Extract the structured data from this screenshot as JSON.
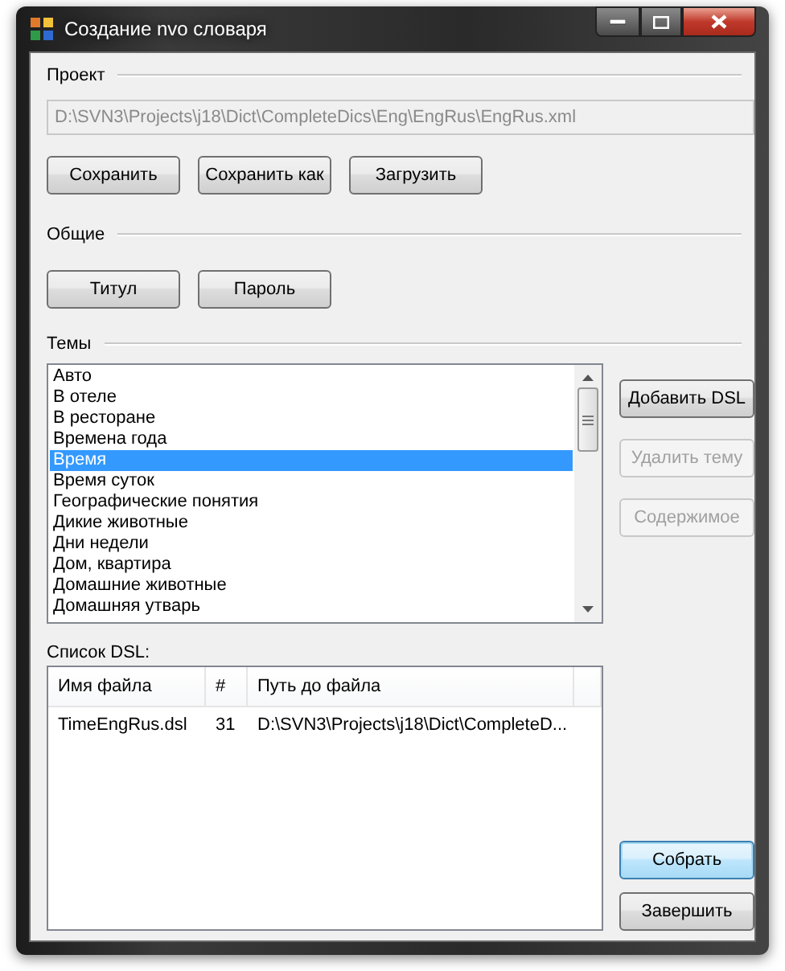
{
  "window": {
    "title": "Создание nvo словаря"
  },
  "project": {
    "label": "Проект",
    "path": "D:\\SVN3\\Projects\\j18\\Dict\\CompleteDics\\Eng\\EngRus\\EngRus.xml",
    "path_disabled": true,
    "buttons": [
      {
        "label": "Сохранить",
        "disabled": false,
        "default": false
      },
      {
        "label": "Сохранить как",
        "disabled": false,
        "default": false
      },
      {
        "label": "Загрузить",
        "disabled": false,
        "default": false
      }
    ]
  },
  "general": {
    "label": "Общие",
    "buttons": [
      {
        "label": "Титул",
        "disabled": false,
        "default": false
      },
      {
        "label": "Пароль",
        "disabled": false,
        "default": false
      }
    ]
  },
  "topics": {
    "label": "Темы",
    "items": [
      {
        "label": "Авто",
        "selected": false
      },
      {
        "label": "В отеле",
        "selected": false
      },
      {
        "label": "В ресторане",
        "selected": false
      },
      {
        "label": "Времена года",
        "selected": false
      },
      {
        "label": "Время",
        "selected": true
      },
      {
        "label": "Время суток",
        "selected": false
      },
      {
        "label": "Географические понятия",
        "selected": false
      },
      {
        "label": "Дикие животные",
        "selected": false
      },
      {
        "label": "Дни недели",
        "selected": false
      },
      {
        "label": "Дом, квартира",
        "selected": false
      },
      {
        "label": "Домашние животные",
        "selected": false
      },
      {
        "label": "Домашняя утварь",
        "selected": false
      }
    ],
    "buttons": [
      {
        "label": "Добавить DSL",
        "disabled": false,
        "default": false
      },
      {
        "label": "Удалить тему",
        "disabled": true,
        "default": false
      },
      {
        "label": "Содержимое",
        "disabled": true,
        "default": false
      }
    ]
  },
  "dsl_list": {
    "label": "Список DSL:",
    "columns": [
      "Имя файла",
      "#",
      "Путь до файла"
    ],
    "rows": [
      [
        "TimeEngRus.dsl",
        "31",
        "D:\\SVN3\\Projects\\j18\\Dict\\CompleteD..."
      ]
    ]
  },
  "footer_buttons": [
    {
      "label": "Собрать",
      "disabled": false,
      "default": true
    },
    {
      "label": "Завершить",
      "disabled": false,
      "default": false
    }
  ]
}
